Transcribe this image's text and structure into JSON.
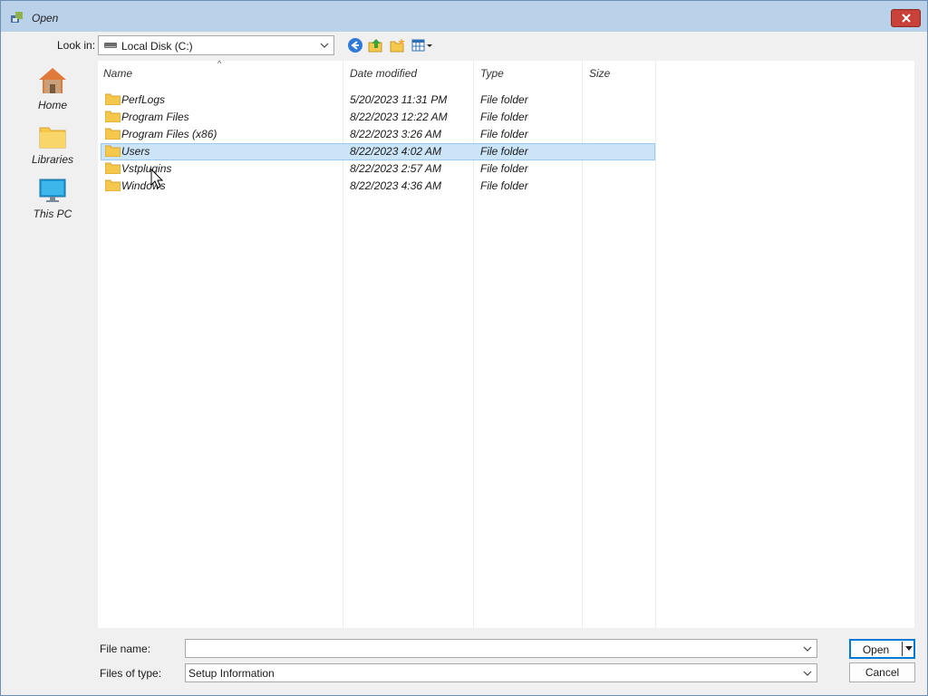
{
  "window": {
    "title": "Open",
    "close_icon": "close-icon"
  },
  "toolbar": {
    "look_in_label": "Look in:",
    "look_in_value": "Local Disk (C:)",
    "buttons": [
      "back-icon",
      "up-folder-icon",
      "new-folder-icon",
      "view-menu-icon"
    ]
  },
  "places": [
    {
      "label": "Home",
      "icon": "home-icon"
    },
    {
      "label": "Libraries",
      "icon": "libraries-icon"
    },
    {
      "label": "This PC",
      "icon": "this-pc-icon"
    }
  ],
  "columns": {
    "name": "Name",
    "date_modified": "Date modified",
    "type": "Type",
    "size": "Size"
  },
  "files": [
    {
      "name": "PerfLogs",
      "date": "5/20/2023 11:31 PM",
      "type": "File folder",
      "size": ""
    },
    {
      "name": "Program Files",
      "date": "8/22/2023 12:22 AM",
      "type": "File folder",
      "size": ""
    },
    {
      "name": "Program Files (x86)",
      "date": "8/22/2023 3:26 AM",
      "type": "File folder",
      "size": ""
    },
    {
      "name": "Users",
      "date": "8/22/2023 4:02 AM",
      "type": "File folder",
      "size": "",
      "selected": true
    },
    {
      "name": "Vstplugins",
      "date": "8/22/2023 2:57 AM",
      "type": "File folder",
      "size": ""
    },
    {
      "name": "Windows",
      "date": "8/22/2023 4:36 AM",
      "type": "File folder",
      "size": ""
    }
  ],
  "bottom": {
    "file_name_label": "File name:",
    "file_name_value": "",
    "file_type_label": "Files of type:",
    "file_type_value": "Setup Information",
    "open_label": "Open",
    "cancel_label": "Cancel"
  },
  "colors": {
    "titlebar": "#bad1ea",
    "selection": "#cce4f7",
    "close": "#c9423a",
    "folder": "#f5c84c"
  }
}
